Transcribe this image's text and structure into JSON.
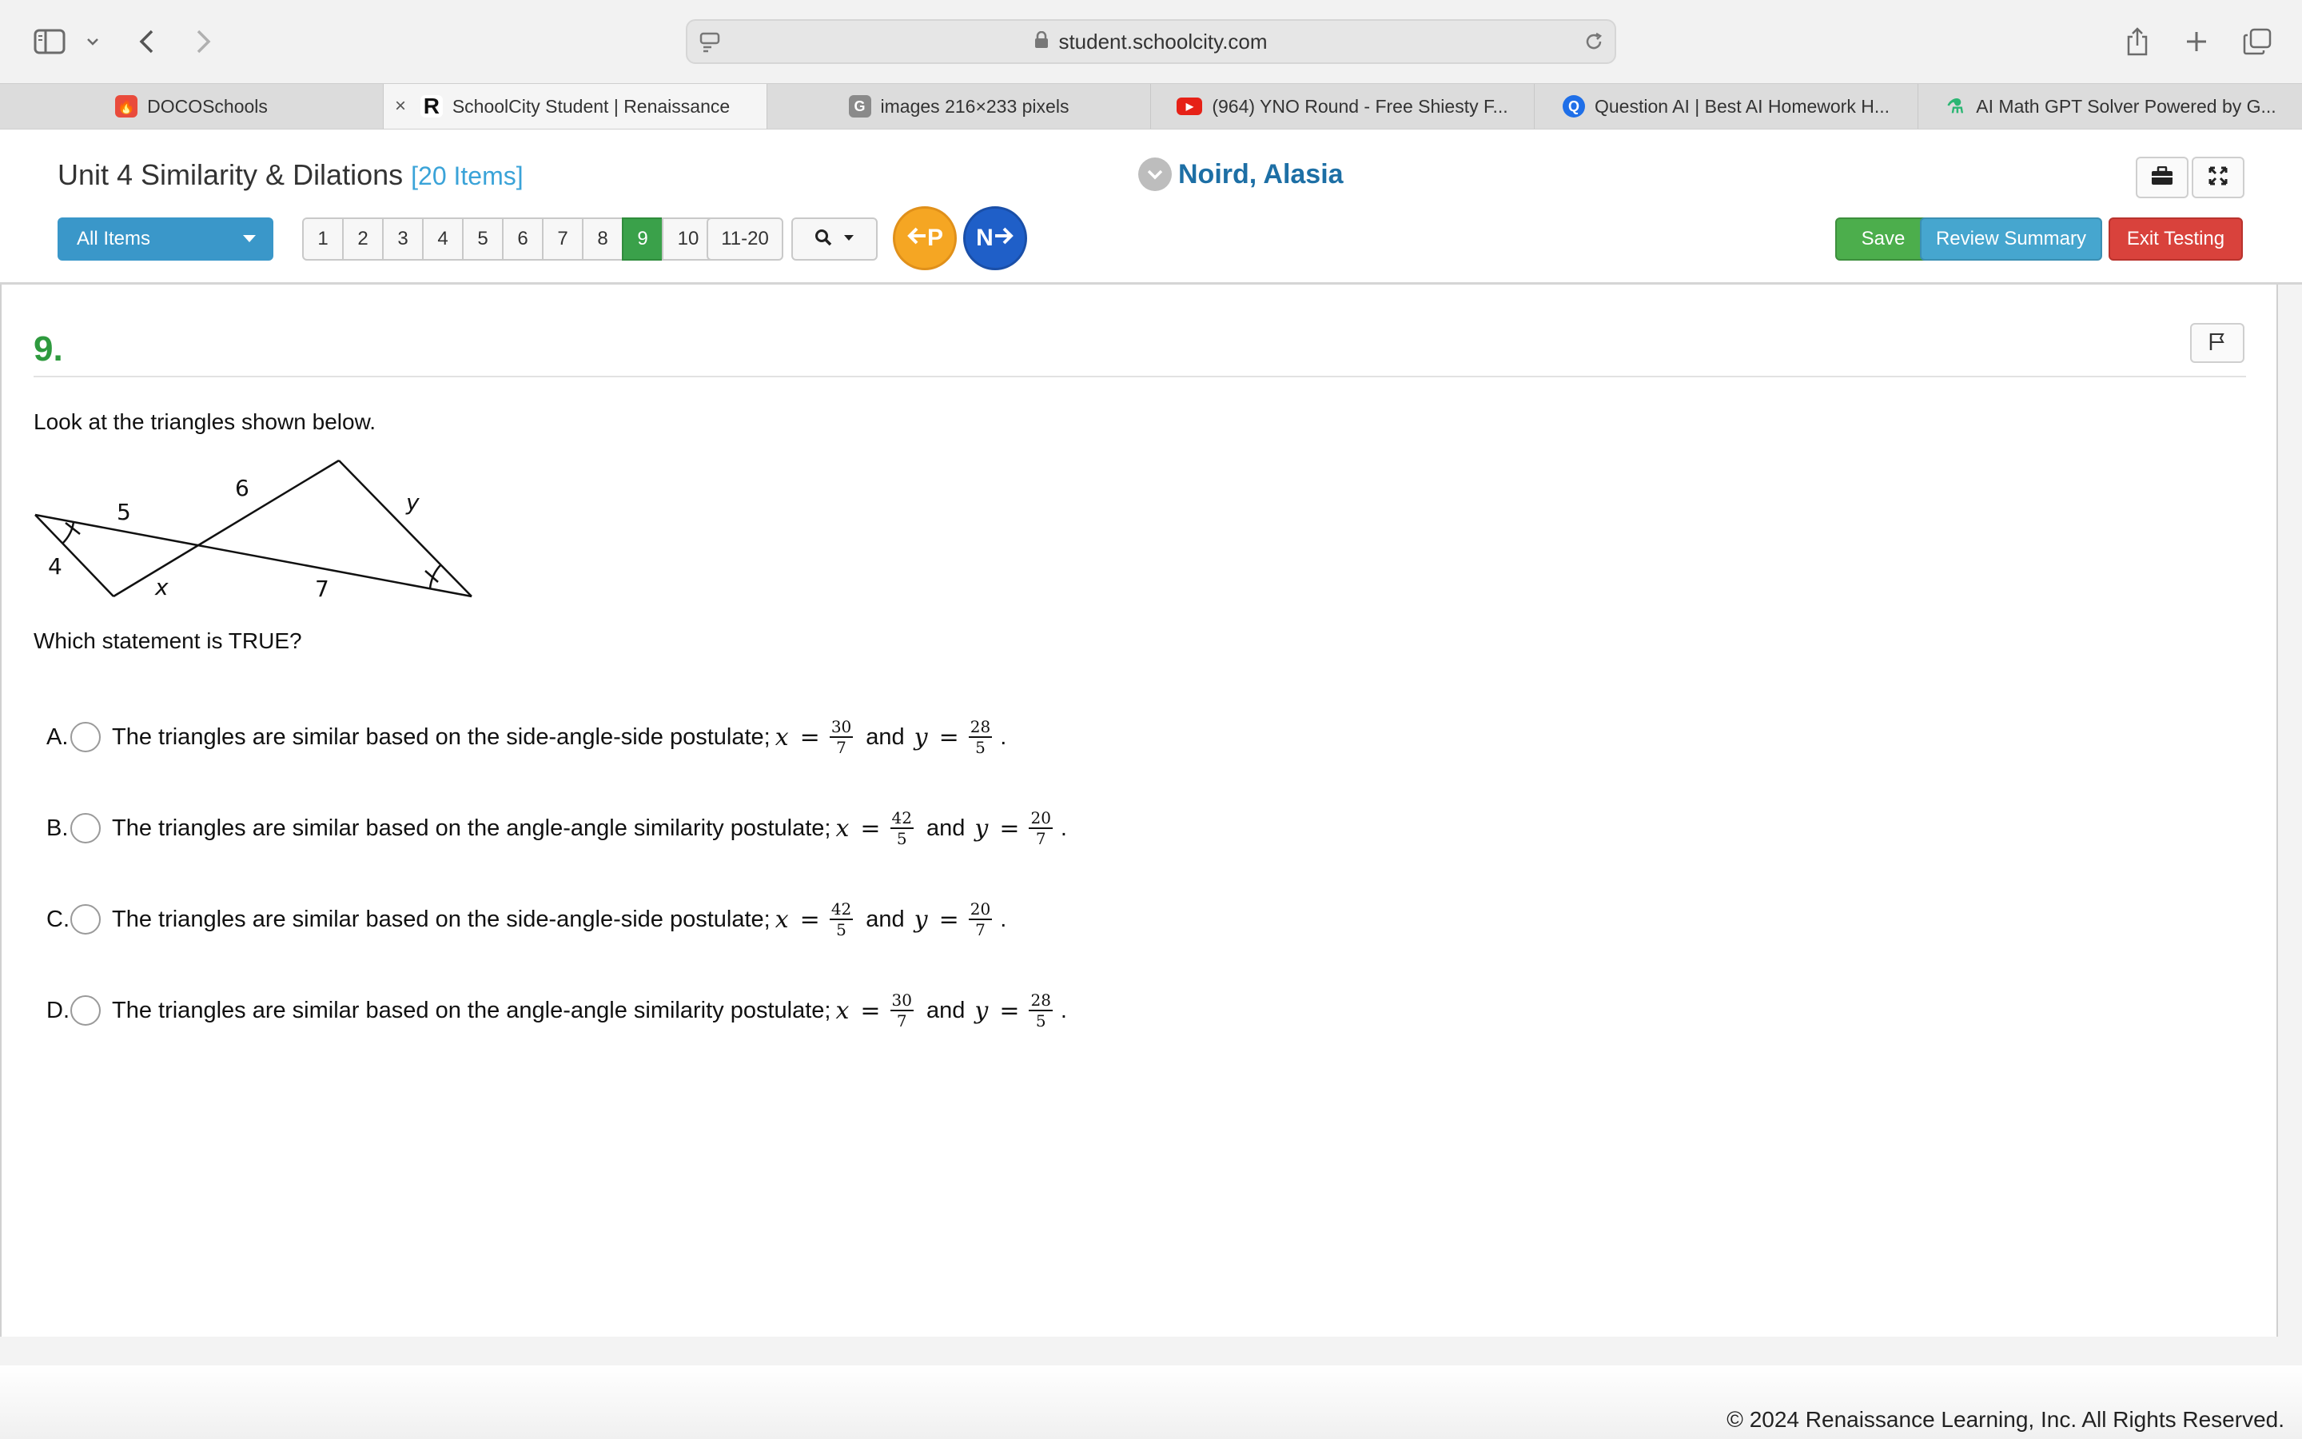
{
  "browser": {
    "url": "student.schoolcity.com",
    "tabs": [
      {
        "title": "DOCOSchools",
        "icon": "fire-icon",
        "active": false
      },
      {
        "title": "SchoolCity Student | Renaissance",
        "icon": "renaissance-icon",
        "active": true
      },
      {
        "title": "images 216×233 pixels",
        "icon": "g-icon",
        "active": false
      },
      {
        "title": "(964) YNO Round - Free Shiesty F...",
        "icon": "youtube-icon",
        "active": false
      },
      {
        "title": "Question AI | Best AI Homework H...",
        "icon": "question-ai-icon",
        "active": false
      },
      {
        "title": "AI Math GPT Solver Powered by G...",
        "icon": "math-gpt-icon",
        "active": false
      }
    ]
  },
  "header": {
    "unit_title": "Unit 4 Similarity & Dilations",
    "item_count": "[20 Items]",
    "student_name": "Noird, Alasia",
    "filter_label": "All Items",
    "pages": [
      "1",
      "2",
      "3",
      "4",
      "5",
      "6",
      "7",
      "8",
      "9",
      "10"
    ],
    "active_page": "9",
    "range_label": "11-20",
    "prev_label": "P",
    "next_label": "N",
    "save_label": "Save",
    "review_label": "Review Summary",
    "exit_label": "Exit Testing"
  },
  "question": {
    "number": "9.",
    "prompt": "Look at the triangles shown below.",
    "stem": "Which statement is TRUE?",
    "figure_labels": {
      "side_a": "5",
      "side_b": "6",
      "side_c": "4",
      "side_x": "x",
      "side_y": "y",
      "side_7": "7"
    },
    "choices": [
      {
        "letter": "A.",
        "text": "The triangles are similar based on the side-angle-side postulate;",
        "x_num": "30",
        "x_den": "7",
        "y_num": "28",
        "y_den": "5"
      },
      {
        "letter": "B.",
        "text": "The triangles are similar based on the angle-angle similarity postulate;",
        "x_num": "42",
        "x_den": "5",
        "y_num": "20",
        "y_den": "7"
      },
      {
        "letter": "C.",
        "text": "The triangles are similar based on the side-angle-side postulate;",
        "x_num": "42",
        "x_den": "5",
        "y_num": "20",
        "y_den": "7"
      },
      {
        "letter": "D.",
        "text": "The triangles are similar based on the angle-angle similarity postulate;",
        "x_num": "30",
        "x_den": "7",
        "y_num": "28",
        "y_den": "5"
      }
    ],
    "math": {
      "x": "x",
      "y": "y",
      "eq": "=",
      "and": "and",
      "period": "."
    }
  },
  "footer": {
    "copyright": "© 2024 Renaissance Learning, Inc. All Rights Reserved."
  }
}
